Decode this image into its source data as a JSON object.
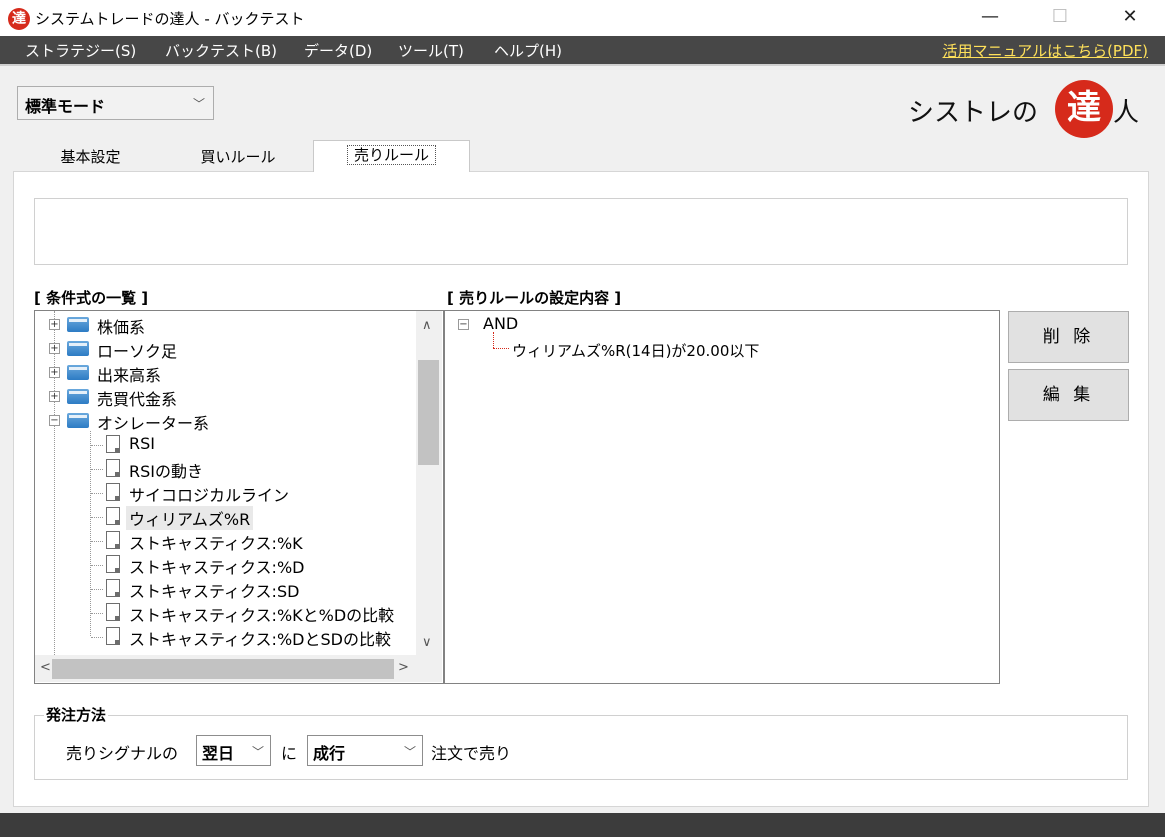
{
  "window": {
    "title": "システムトレードの達人 - バックテスト",
    "icon_char": "達",
    "minimize": "—",
    "maximize": "☐",
    "close": "✕"
  },
  "menu": {
    "items": [
      "ストラテジー(S)",
      "バックテスト(B)",
      "データ(D)",
      "ツール(T)",
      "ヘルプ(H)"
    ],
    "manual_link": "活用マニュアルはこちら(PDF)"
  },
  "mode": {
    "selected": "標準モード"
  },
  "logo": {
    "text": "シストレの",
    "highlight": "達",
    "tail": "人"
  },
  "tabs": [
    {
      "label": "基本設定"
    },
    {
      "label": "買いルール"
    },
    {
      "label": "売りルール"
    }
  ],
  "conditions": {
    "label": "[ 条件式の一覧 ]",
    "categories": [
      "株価系",
      "ローソク足",
      "出来高系",
      "売買代金系",
      "オシレーター系"
    ],
    "oscillator_items": [
      "RSI",
      "RSIの動き",
      "サイコロジカルライン",
      "ウィリアムズ%R",
      "ストキャスティクス:%K",
      "ストキャスティクス:%D",
      "ストキャスティクス:SD",
      "ストキャスティクス:%Kと%Dの比較",
      "ストキャスティクス:%DとSDの比較"
    ],
    "selected": "ウィリアムズ%R"
  },
  "rules": {
    "label": "[ 売りルールの設定内容 ]",
    "root": "AND",
    "child": "ウィリアムズ%R(14日)が20.00以下"
  },
  "buttons": {
    "delete": "削 除",
    "edit": "編 集"
  },
  "order": {
    "legend": "発注方法",
    "prefix": "売りシグナルの",
    "day_value": "翌日",
    "middle": "に",
    "type_value": "成行",
    "suffix": "注文で売り"
  }
}
